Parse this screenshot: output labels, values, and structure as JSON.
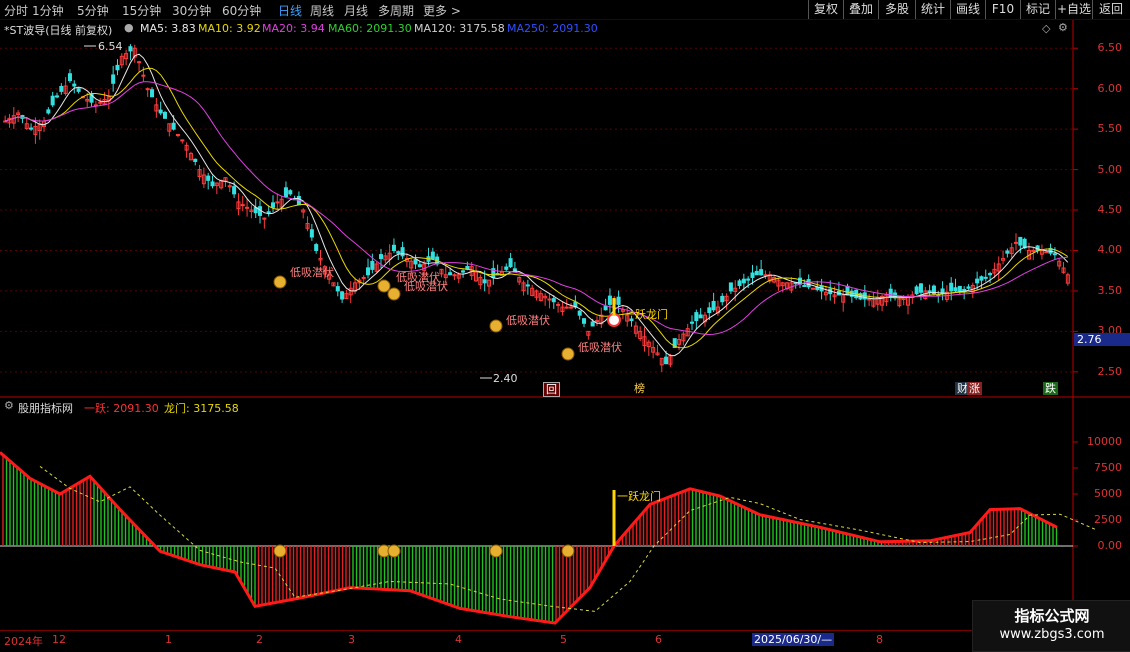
{
  "topbar": {
    "period_tabs": [
      "分时",
      "1分钟",
      "5分钟",
      "15分钟",
      "30分钟",
      "60分钟",
      "日线",
      "周线",
      "月线",
      "多周期",
      "更多 >"
    ],
    "active_tab": "日线",
    "right_buttons": [
      "复权",
      "叠加",
      "多股",
      "统计",
      "画线",
      "F10",
      "标记",
      "+自选",
      "返回"
    ]
  },
  "main": {
    "title": "*ST波导(日线 前复权)",
    "ma_labels": [
      {
        "text": "MA5: 3.83",
        "color": "#e8e8e8"
      },
      {
        "text": "MA10: 3.92",
        "color": "#e8d800"
      },
      {
        "text": "MA20: 3.94",
        "color": "#e040e0"
      },
      {
        "text": "MA60: 2091.30",
        "color": "#30d030"
      },
      {
        "text": "MA120: 3175.58",
        "color": "#d0d0d0"
      },
      {
        "text": "MA250: 2091.30",
        "color": "#3050ff"
      }
    ],
    "y_ticks": [
      "6.50",
      "6.00",
      "5.50",
      "5.00",
      "4.50",
      "4.00",
      "3.50",
      "3.00",
      "2.50"
    ],
    "price_box": "2.76",
    "high_label": "6.54",
    "low_label": "2.40",
    "signal_labels": [
      "低吸潜伏",
      "低吸潜伏",
      "低吸潜伏",
      "低吸潜伏",
      "低吸潜伏",
      "一跃龙门"
    ],
    "bottom_tags": [
      "回",
      "榜",
      "财",
      "涨",
      "跌"
    ]
  },
  "sub": {
    "title": "股朋指标网",
    "line1": "一跃: 2091.30",
    "line2": "龙门: 3175.58",
    "y_ticks": [
      "10000",
      "7500",
      "5000",
      "2500",
      "0.00"
    ],
    "signal_label": "一跃龙门"
  },
  "datebar": {
    "labels": [
      "2024年",
      "12",
      "1",
      "2",
      "3",
      "4",
      "5",
      "6",
      "2025/06/30/—",
      "8"
    ]
  },
  "watermark": {
    "line1": "指标公式网",
    "line2": "www.zbgs3.com"
  },
  "chart_data": {
    "type": "candlestick",
    "title": "*ST波导(日线 前复权)",
    "ylim": [
      2.3,
      6.75
    ],
    "high": 6.54,
    "low": 2.4,
    "close_path": [
      5.6,
      5.7,
      5.5,
      5.6,
      5.9,
      6.1,
      5.9,
      5.8,
      5.9,
      6.4,
      6.5,
      6.0,
      5.7,
      5.5,
      5.3,
      5.0,
      4.8,
      4.9,
      4.6,
      4.5,
      4.4,
      4.6,
      4.7,
      4.5,
      4.0,
      3.7,
      3.4,
      3.6,
      3.7,
      3.9,
      4.0,
      3.9,
      3.8,
      3.9,
      3.7,
      3.7,
      3.8,
      3.6,
      3.7,
      3.8,
      3.6,
      3.5,
      3.4,
      3.3,
      3.3,
      3.0,
      3.2,
      3.4,
      3.2,
      3.0,
      2.8,
      2.6,
      2.9,
      3.1,
      3.2,
      3.3,
      3.5,
      3.6,
      3.7,
      3.7,
      3.6,
      3.6,
      3.55,
      3.5,
      3.45,
      3.45,
      3.4,
      3.4,
      3.45,
      3.4,
      3.45,
      3.5,
      3.45,
      3.5,
      3.5,
      3.6,
      3.7,
      3.9,
      4.1,
      4.0,
      4.0,
      3.95,
      3.7
    ],
    "indicator": {
      "name": "股朋指标网",
      "series": [
        {
          "name": "一跃",
          "last": 2091.3
        },
        {
          "name": "龙门",
          "last": 3175.58
        }
      ],
      "ylim": [
        -9000,
        12500
      ]
    }
  }
}
